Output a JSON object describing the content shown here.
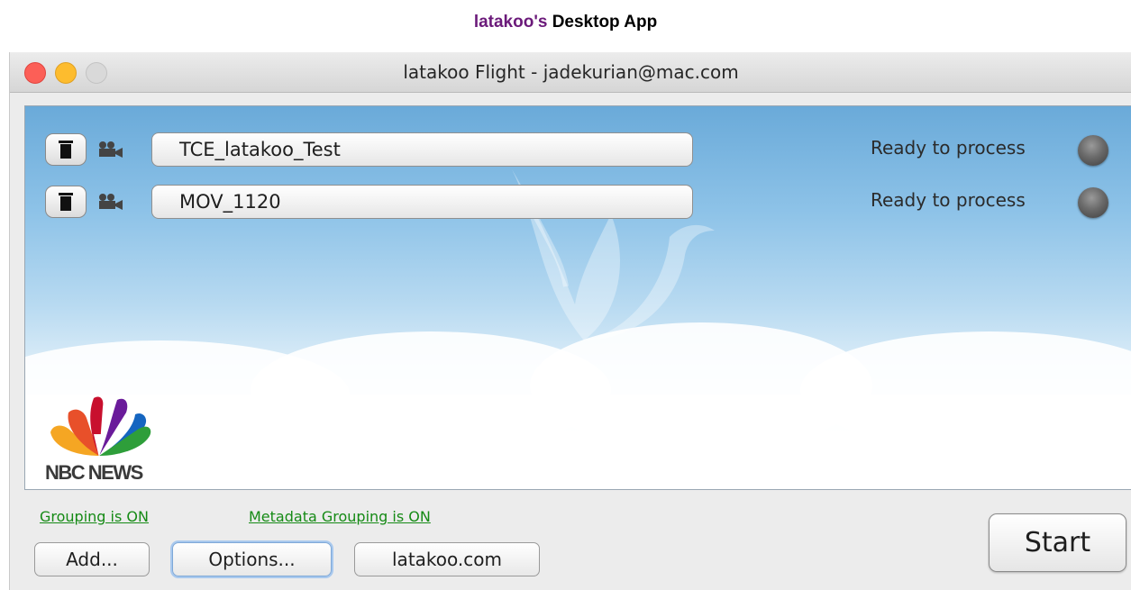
{
  "page": {
    "heading_brand": "latakoo's",
    "heading_rest": "Desktop App"
  },
  "window": {
    "title": "latakoo Flight - jadekurian@mac.com"
  },
  "files": [
    {
      "name": "TCE_latakoo_Test",
      "status": "Ready to process"
    },
    {
      "name": "MOV_1120",
      "status": "Ready to process"
    }
  ],
  "logo": {
    "text": "NBC NEWS"
  },
  "links": {
    "grouping": "Grouping is ON",
    "metadata_grouping": "Metadata Grouping is ON"
  },
  "buttons": {
    "add": "Add...",
    "options": "Options...",
    "latakoo": "latakoo.com",
    "start": "Start"
  },
  "colors": {
    "heading_brand": "#6b1a7a",
    "link": "#158a15",
    "close": "#fc5f57",
    "minimize": "#fdbc2e",
    "zoom": "#d9d9d9"
  }
}
